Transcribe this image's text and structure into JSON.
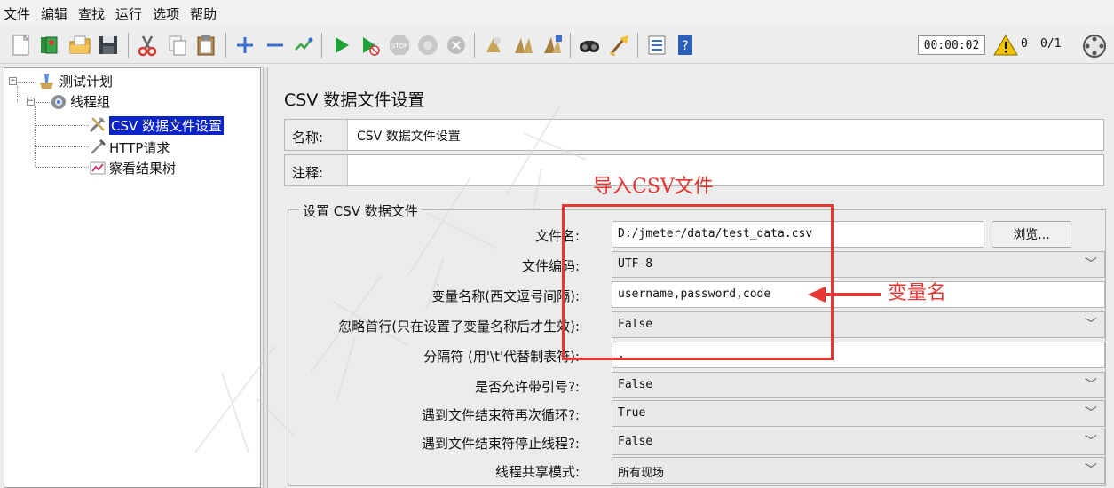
{
  "menu": {
    "file": "文件",
    "edit": "编辑",
    "search": "查找",
    "run": "运行",
    "options": "选项",
    "help": "帮助"
  },
  "toolbar": {
    "icons": [
      "new-icon",
      "templates-icon",
      "open-icon",
      "save-icon",
      "cut-icon",
      "copy-icon",
      "paste-icon",
      "expand-icon",
      "collapse-icon",
      "toggle-icon",
      "start-icon",
      "start-no-pause-icon",
      "stop-icon",
      "shutdown-icon",
      "clear-icon",
      "clear-all-icon",
      "search-icon",
      "reset-search-icon",
      "function-helper-icon",
      "help-icon"
    ],
    "timer": "00:00:02",
    "warn_count": "0",
    "thread_count": "0/1"
  },
  "tree": {
    "test_plan": "测试计划",
    "thread_group": "线程组",
    "csv_config": "CSV 数据文件设置",
    "http_request": "HTTP请求",
    "results_tree": "察看结果树"
  },
  "panel": {
    "title": "CSV 数据文件设置",
    "name_label": "名称:",
    "name_value": "CSV 数据文件设置",
    "comment_label": "注释:",
    "comment_value": "",
    "group_title": "设置 CSV 数据文件",
    "fields": {
      "filename": {
        "label": "文件名:",
        "value": "D:/jmeter/data/test_data.csv"
      },
      "encoding": {
        "label": "文件编码:",
        "value": "UTF-8"
      },
      "var_names": {
        "label": "变量名称(西文逗号间隔):",
        "value": "username,password,code"
      },
      "ignore_first": {
        "label": "忽略首行(只在设置了变量名称后才生效):",
        "value": "False"
      },
      "delimiter": {
        "label": "分隔符 (用'\\t'代替制表符):",
        "value": ","
      },
      "quoted": {
        "label": "是否允许带引号?:",
        "value": "False"
      },
      "recycle": {
        "label": "遇到文件结束符再次循环?:",
        "value": "True"
      },
      "stop_thread": {
        "label": "遇到文件结束符停止线程?:",
        "value": "False"
      },
      "share_mode": {
        "label": "线程共享模式:",
        "value": "所有现场"
      }
    },
    "browse": "浏览..."
  },
  "annotations": {
    "import": "导入CSV文件",
    "varname": "变量名",
    "color": "#e83632"
  },
  "colors": {
    "selection": "#0a24c8",
    "accent_red": "#e83632"
  }
}
